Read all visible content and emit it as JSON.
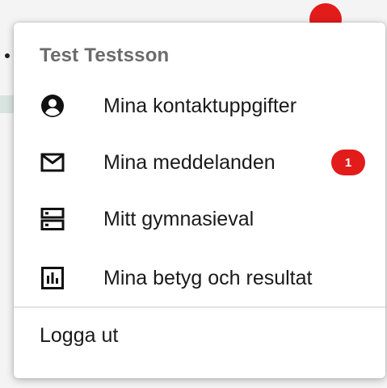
{
  "user": {
    "name": "Test Testsson"
  },
  "menu": {
    "items": [
      {
        "label": "Mina kontaktuppgifter",
        "icon": "account-circle-icon"
      },
      {
        "label": "Mina meddelanden",
        "icon": "mail-icon",
        "badge": "1"
      },
      {
        "label": "Mitt gymnasieval",
        "icon": "storage-icon"
      },
      {
        "label": "Mina betyg och resultat",
        "icon": "bar-chart-icon"
      }
    ],
    "logout_label": "Logga ut"
  },
  "colors": {
    "badge": "#e21b1b",
    "username": "#6b6b6b",
    "text": "#1a1a1a"
  }
}
